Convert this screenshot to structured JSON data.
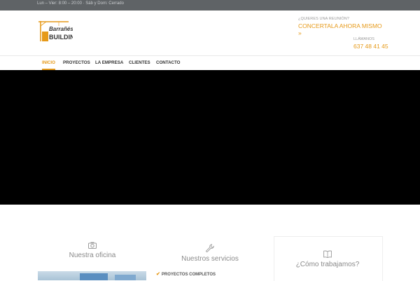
{
  "topbar": {
    "hours": "Lun – Vier: 8:00 – 20:00 · Sáb y Dom: Cerrado"
  },
  "brand": {
    "logo_top": "Barrañés",
    "logo_bottom": "BUILDING"
  },
  "header": {
    "meeting_question": "¿QUIERES UNA REUNIÓN?",
    "meeting_link": "CONCERTALA AHORA MISMO »",
    "call_label": "LLÁMANOS",
    "phone": "637 48 41 45"
  },
  "nav": {
    "items": [
      {
        "label": "INICIO",
        "active": true
      },
      {
        "label": "PROYECTOS",
        "active": false
      },
      {
        "label": "LA EMPRESA",
        "active": false
      },
      {
        "label": "CLIENTES",
        "active": false
      },
      {
        "label": "CONTACTO",
        "active": false
      }
    ]
  },
  "hero": {
    "background": "#000000"
  },
  "features": [
    {
      "icon": "camera-icon",
      "title": "Nuestra oficina"
    },
    {
      "icon": "wrench-icon",
      "title": "Nuestros servicios",
      "items": [
        "PROYECTOS COMPLETOS"
      ]
    },
    {
      "icon": "book-icon",
      "title": "¿Cómo trabajamos?"
    }
  ],
  "colors": {
    "accent": "#e69a1a",
    "topbar": "#5f6366",
    "text": "#333333"
  }
}
